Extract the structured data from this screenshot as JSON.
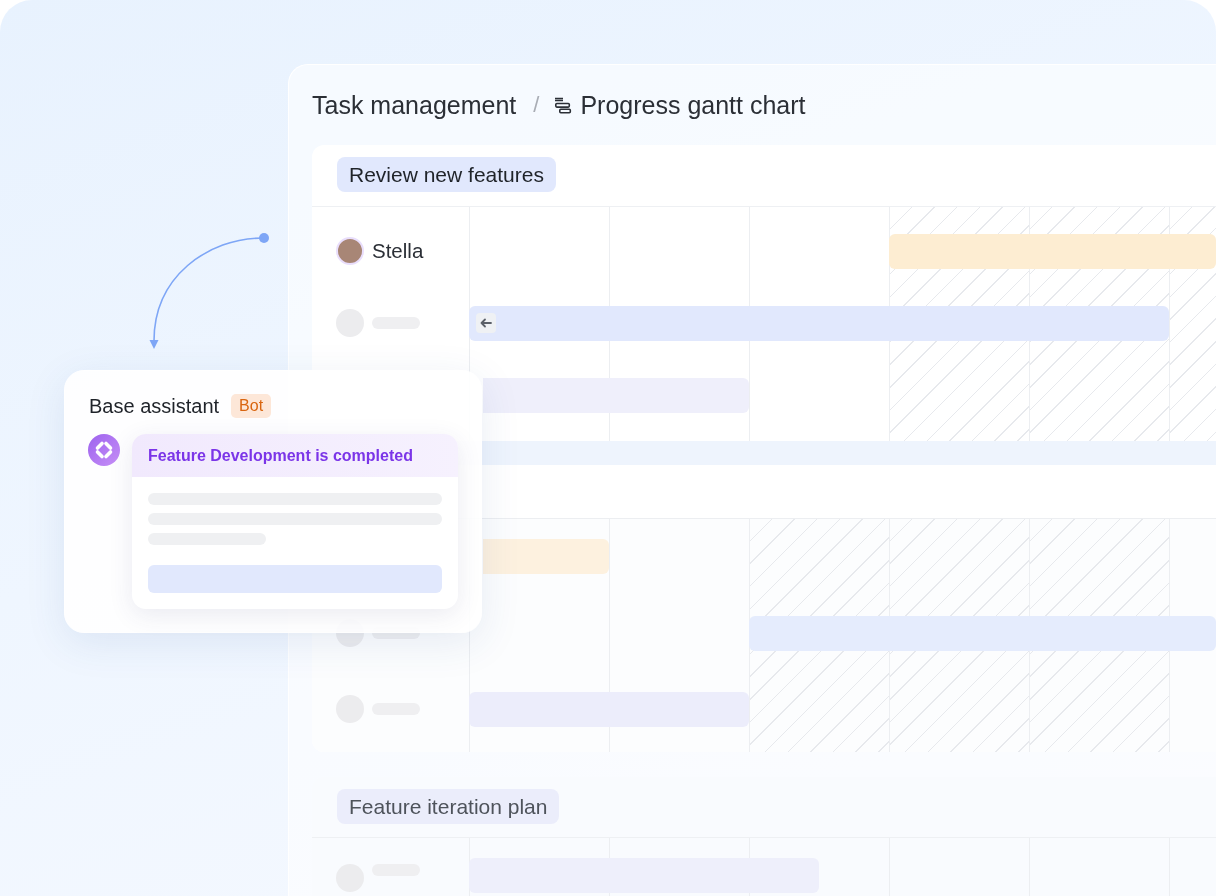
{
  "breadcrumb": {
    "parent": "Task management",
    "separator": "/",
    "current": "Progress gantt chart"
  },
  "sections": [
    {
      "title": "Review new features",
      "color": "#e1e8fd",
      "groups": [
        {
          "rows": [
            {
              "kind": "person",
              "name": "Stella",
              "color": "#fdedd2"
            },
            {
              "kind": "placeholder",
              "color": "#e1e8fd"
            },
            {
              "kind": "bar",
              "color": "#efeffb"
            }
          ]
        },
        {
          "rows": [
            {
              "kind": "bar",
              "color": "#fdf1df"
            },
            {
              "kind": "placeholder",
              "color": "#e5ecfd"
            },
            {
              "kind": "placeholder",
              "color": "#ecedfb"
            }
          ]
        }
      ]
    },
    {
      "title": "Feature iteration plan",
      "color": "#ebedfb",
      "groups": [
        {
          "rows": [
            {
              "kind": "placeholder",
              "color": "#eeeffb"
            }
          ]
        }
      ]
    }
  ],
  "assistant": {
    "name": "Base assistant",
    "tag": "Bot",
    "message": "Feature Development is completed"
  }
}
